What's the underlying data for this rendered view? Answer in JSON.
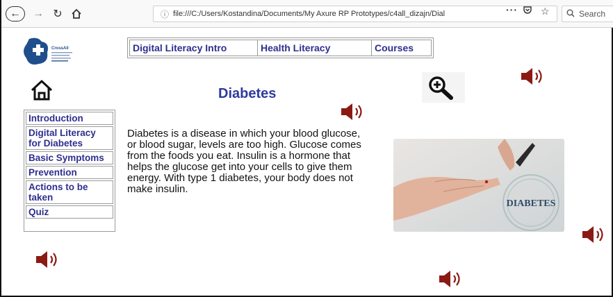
{
  "browser": {
    "url_icon": "ⓘ",
    "url": "file:///C:/Users/Kostandina/Documents/My Axure RP Prototypes/c4all_dizajn/Dial",
    "more": "···",
    "search_placeholder": "Search"
  },
  "logo": {
    "brand": "CrossAll"
  },
  "topnav": [
    {
      "label": "Digital Literacy Intro"
    },
    {
      "label": "Health Literacy"
    },
    {
      "label": "Courses"
    }
  ],
  "page": {
    "title": "Diabetes",
    "body": "Diabetes is a disease in which your blood glucose, or blood sugar, levels are too high. Glucose comes from the foods you eat. Insulin is a hormone that helps the glucose get into your cells to give them energy. With type 1 diabetes, your body does not make insulin.",
    "image_caption": "DIABETES"
  },
  "sidemenu": [
    {
      "label": "Introduction"
    },
    {
      "label": "Digital Literacy for  Diabetes"
    },
    {
      "label": "Basic Symptoms"
    },
    {
      "label": "Prevention"
    },
    {
      "label": "Actions to be taken"
    },
    {
      "label": "Quiz"
    }
  ],
  "icons": {
    "speaker": "speaker-icon",
    "zoom": "zoom-in-icon",
    "home": "home-icon"
  },
  "colors": {
    "link": "#2e2e8f",
    "title": "#2e3a9f",
    "speaker": "#8b1a14",
    "logo_blue": "#1f4e8c"
  }
}
